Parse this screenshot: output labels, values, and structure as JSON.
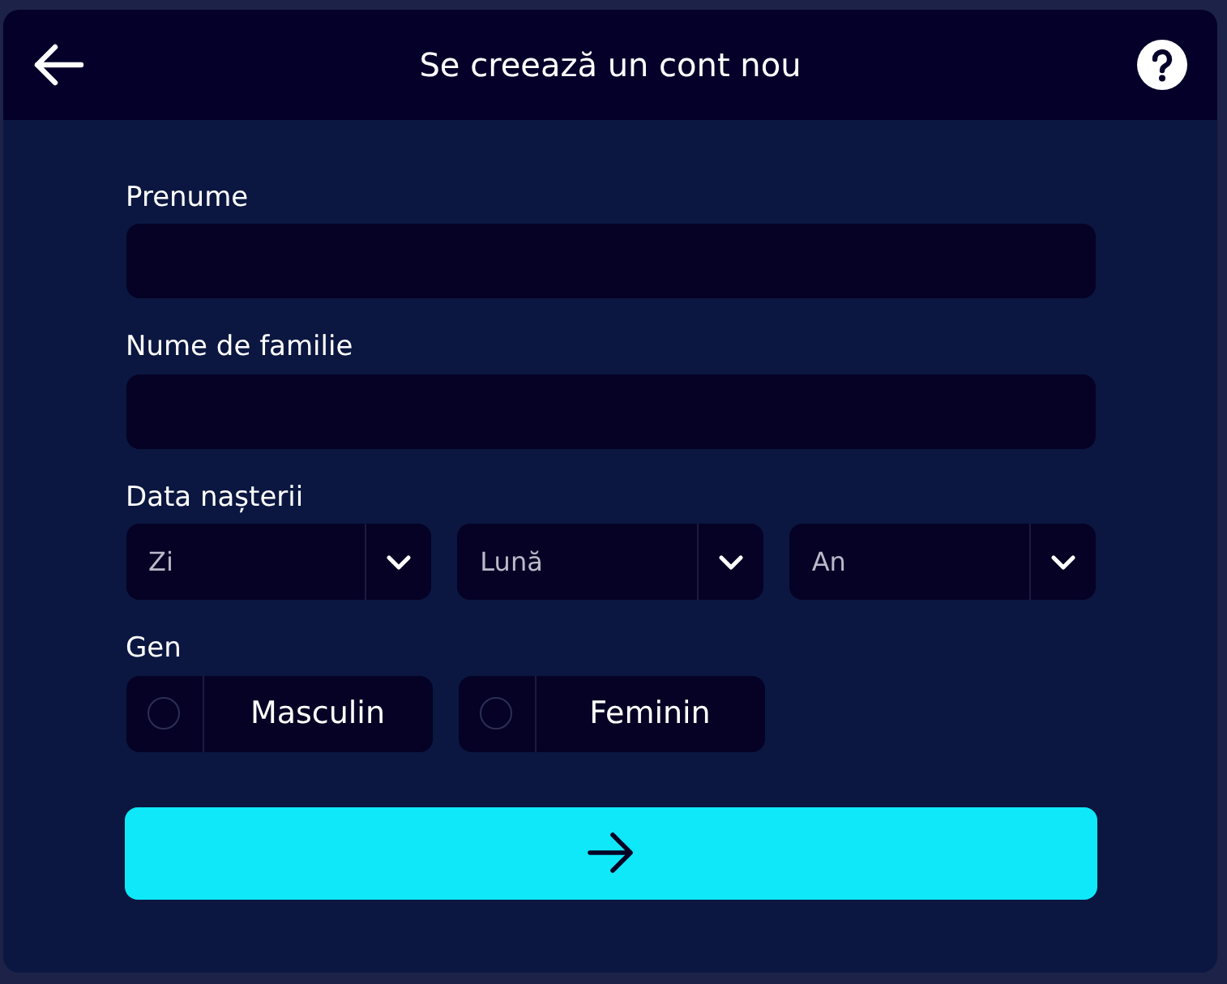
{
  "header": {
    "title": "Se creează un cont nou"
  },
  "fields": [
    {
      "label": "Prenume"
    },
    {
      "label": "Nume de familie"
    }
  ],
  "birth_date": {
    "label": "Data nașterii",
    "dropdowns": [
      {
        "placeholder": "Zi"
      },
      {
        "placeholder": "Lună"
      },
      {
        "placeholder": "An"
      }
    ]
  },
  "gender": {
    "label": "Gen",
    "options": [
      {
        "label": "Masculin",
        "selected": false
      },
      {
        "label": "Feminin",
        "selected": false
      }
    ]
  }
}
